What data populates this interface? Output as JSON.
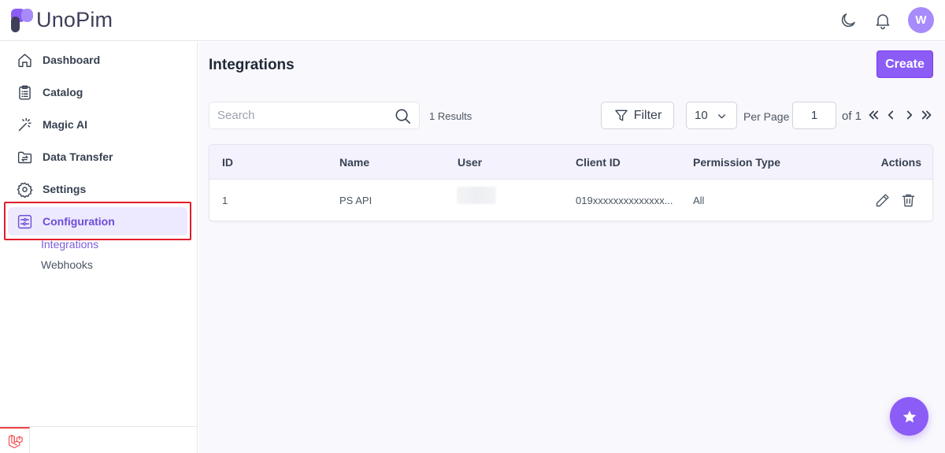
{
  "brand": {
    "name": "UnoPim",
    "logo_icon": "unopim-logo-icon"
  },
  "header": {
    "theme_icon": "moon-icon",
    "notification_icon": "bell-icon",
    "avatar_initial": "W"
  },
  "sidebar": {
    "items": [
      {
        "label": "Dashboard",
        "icon": "home-icon"
      },
      {
        "label": "Catalog",
        "icon": "clipboard-icon"
      },
      {
        "label": "Magic AI",
        "icon": "magic-wand-icon"
      },
      {
        "label": "Data Transfer",
        "icon": "folder-transfer-icon"
      },
      {
        "label": "Settings",
        "icon": "gear-icon"
      },
      {
        "label": "Configuration",
        "icon": "sliders-icon",
        "active": true
      }
    ],
    "sub_items": [
      {
        "label": "Integrations",
        "active": true
      },
      {
        "label": "Webhooks"
      }
    ],
    "footer_icon": "laravel-icon"
  },
  "main": {
    "title": "Integrations",
    "create_label": "Create",
    "search_placeholder": "Search",
    "results_text": "1 Results",
    "filter_label": "Filter",
    "per_page_value": "10",
    "per_page_label": "Per Page",
    "page_value": "1",
    "page_total_text": "of 1",
    "table": {
      "columns": [
        "ID",
        "Name",
        "User",
        "Client ID",
        "Permission Type",
        "Actions"
      ],
      "rows": [
        {
          "id": "1",
          "name": "PS API",
          "user": "",
          "client_id": "019xxxxxxxxxxxxxx...",
          "permission_type": "All"
        }
      ]
    }
  },
  "colors": {
    "accent": "#8b5cf6",
    "active_bg": "#ede9fe",
    "highlight": "#e11d2a"
  }
}
